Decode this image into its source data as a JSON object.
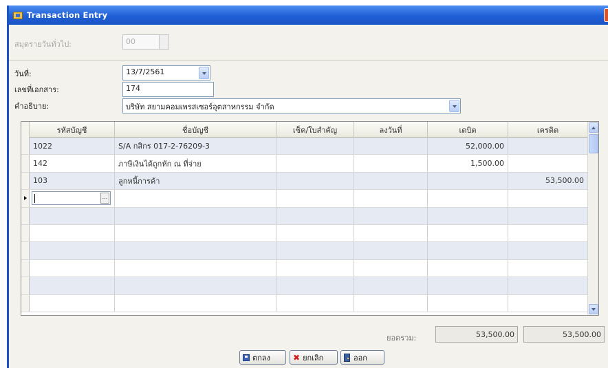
{
  "window": {
    "title": "Transaction Entry"
  },
  "top": {
    "label": "สมุดรายวันทั่วไป:",
    "code_value": "00"
  },
  "form": {
    "date_label": "วันที่:",
    "date_value": "13/7/2561",
    "doc_label": "เลขที่เอกสาร:",
    "doc_value": "174",
    "desc_label": "คำอธิบาย:",
    "desc_value": "บริษัท สยามคอมเพรสเซอร์อุตสาหกรรม จำกัด"
  },
  "grid": {
    "headers": [
      "รหัสบัญชี",
      "ชื่อบัญชี",
      "เช็ค/ใบสำคัญ",
      "ลงวันที่",
      "เดบิต",
      "เครดิต"
    ],
    "rows": [
      {
        "code": "1022",
        "name": "S/A กสิกร 017-2-76209-3",
        "cheque": "",
        "date": "",
        "debit": "52,000.00",
        "credit": ""
      },
      {
        "code": "142",
        "name": "ภาษีเงินได้ถูกหัก ณ ที่จ่าย",
        "cheque": "",
        "date": "",
        "debit": "1,500.00",
        "credit": ""
      },
      {
        "code": "103",
        "name": "ลูกหนี้การค้า",
        "cheque": "",
        "date": "",
        "debit": "",
        "credit": "53,500.00"
      }
    ]
  },
  "totals": {
    "label": "ยอดรวม:",
    "debit": "53,500.00",
    "credit": "53,500.00"
  },
  "buttons": {
    "ok": "ตกลง",
    "cancel": "ยกเลิก",
    "exit": "ออก"
  }
}
